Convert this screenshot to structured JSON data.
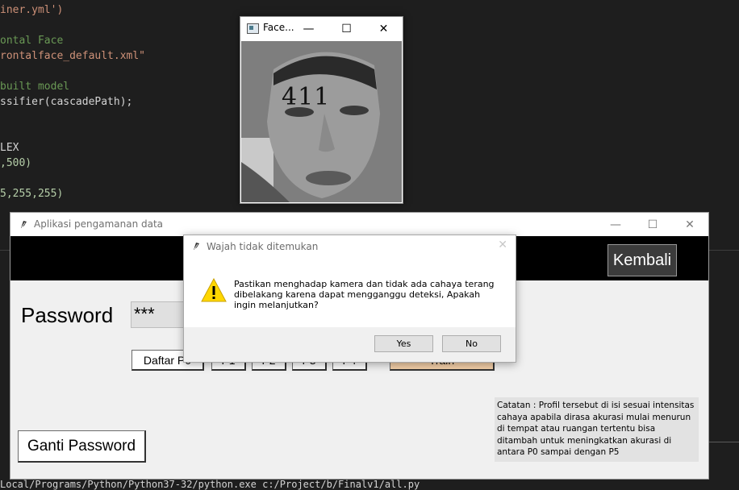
{
  "editor": {
    "lines": [
      {
        "text": "iner.yml')",
        "cls": "c-orange"
      },
      {
        "text": "",
        "cls": "c-white"
      },
      {
        "text": "ontal Face",
        "cls": "c-green"
      },
      {
        "text": "rontalface_default.xml\"",
        "cls": "c-orange"
      },
      {
        "text": "",
        "cls": "c-white"
      },
      {
        "text": "built model",
        "cls": "c-green"
      },
      {
        "text": "ssifier(cascadePath);",
        "cls": "c-white"
      },
      {
        "text": "",
        "cls": "c-white"
      },
      {
        "text": "",
        "cls": "c-white"
      },
      {
        "text": "LEX",
        "cls": "c-white"
      },
      {
        "text": ",500)",
        "cls": "c-num"
      },
      {
        "text": "",
        "cls": "c-white"
      },
      {
        "text": "5,255,255)",
        "cls": "c-num"
      }
    ],
    "bottom_path": "Local/Programs/Python/Python37-32/python.exe c:/Project/b/Finalv1/all.py"
  },
  "face_window": {
    "title": "Face...",
    "minimize": "—",
    "maximize": "☐",
    "close": "✕",
    "label": "411"
  },
  "app": {
    "title": "Aplikasi pengamanan data",
    "minimize": "—",
    "maximize": "☐",
    "close": "✕",
    "back_button": "Kembali",
    "password_label": "Password",
    "password_value": "***",
    "buttons": [
      "Daftar P0",
      "P1",
      "P2",
      "P3",
      "P4",
      "Train"
    ],
    "note": "Catatan : Profil tersebut di isi sesuai intensitas cahaya apabila dirasa akurasi mulai menurun di tempat atau ruangan tertentu bisa ditambah untuk meningkatkan akurasi di antara P0 sampai dengan P5",
    "change_password_button": "Ganti Password"
  },
  "dialog": {
    "title": "Wajah tidak ditemukan",
    "close": "✕",
    "message": "Pastikan menghadap kamera dan tidak ada cahaya terang dibelakang karena dapat mengganggu deteksi, Apakah ingin melanjutkan?",
    "yes": "Yes",
    "no": "No"
  }
}
